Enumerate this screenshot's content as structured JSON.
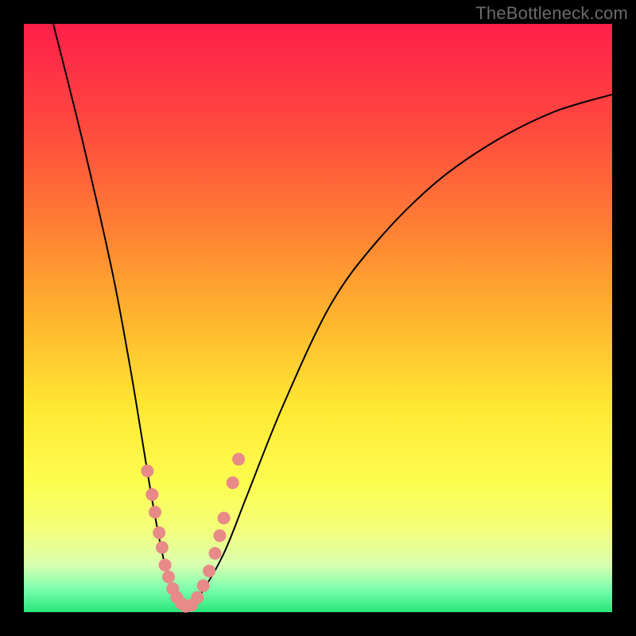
{
  "watermark": "TheBottleneck.com",
  "chart_data": {
    "type": "line",
    "title": "",
    "xlabel": "",
    "ylabel": "",
    "xlim": [
      0,
      100
    ],
    "ylim": [
      0,
      100
    ],
    "series": [
      {
        "name": "bottleneck-curve",
        "x": [
          5,
          10,
          15,
          18,
          20,
          22,
          24,
          26,
          28,
          30,
          34,
          38,
          44,
          52,
          60,
          70,
          80,
          90,
          100
        ],
        "y": [
          100,
          80,
          58,
          42,
          30,
          18,
          8,
          3,
          1,
          3,
          10,
          20,
          35,
          52,
          63,
          73,
          80,
          85,
          88
        ]
      }
    ],
    "points": {
      "name": "highlight-points",
      "x": [
        21.0,
        21.8,
        22.3,
        23.0,
        23.5,
        24.0,
        24.6,
        25.3,
        26.0,
        26.8,
        27.5,
        28.5,
        29.5,
        30.5,
        31.5,
        32.5,
        33.3,
        34.0,
        35.5,
        36.5
      ],
      "y": [
        24.0,
        20.0,
        17.0,
        13.5,
        11.0,
        8.0,
        6.0,
        4.0,
        2.5,
        1.5,
        1.0,
        1.2,
        2.5,
        4.5,
        7.0,
        10.0,
        13.0,
        16.0,
        22.0,
        26.0
      ]
    },
    "gradient_stops": [
      {
        "pos": 0.0,
        "color": "#ff1f4a"
      },
      {
        "pos": 0.5,
        "color": "#ffe733"
      },
      {
        "pos": 1.0,
        "color": "#27e57a"
      }
    ]
  }
}
